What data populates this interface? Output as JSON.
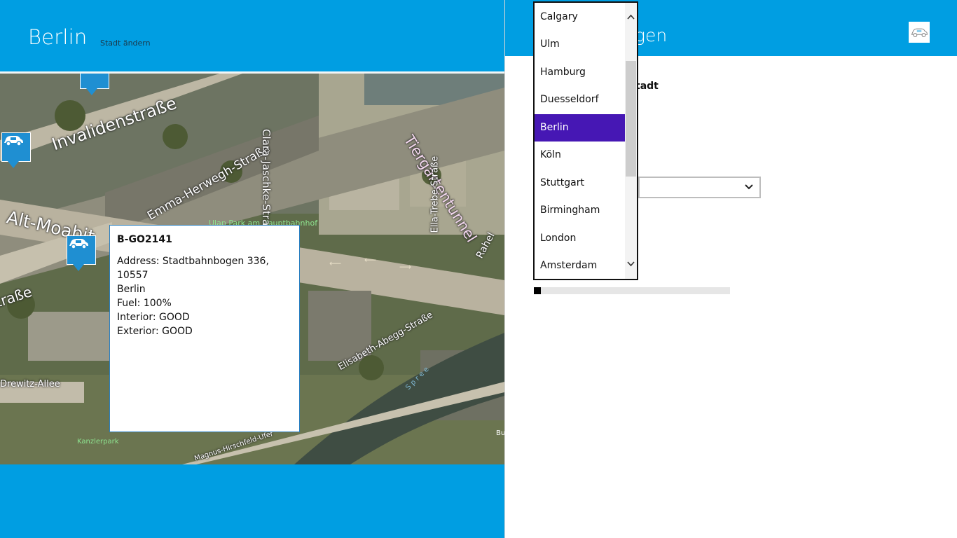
{
  "app": {
    "title": "Berlin",
    "change_city_label": "Stadt ändern"
  },
  "map": {
    "labels": {
      "invalidenstrasse": "Invalidenstraße",
      "emma_herwegh": "Emma-Herwegh-Straße",
      "alt_moabit": "Alt-Moabit",
      "strasse_left": "traße",
      "ulap_park": "Ulap Park am Hauptbahnhof",
      "clara_jaschke": "Clara-Jaschke-Straße",
      "tiergartentunnel": "Tiergartentunnel",
      "ella_trebe": "Ella-Trebe-Straße",
      "rahel": "Rahel",
      "elisabeth_abegg": "Elisabeth-Abegg-Straße",
      "drewitz_allee": "Drewitz-Allee",
      "kanzlerpark": "Kanzlerpark",
      "magnus_hirschfeld": "Magnus-Hirschfeld-Ufer",
      "spree": "S p r e e",
      "bu": "Bu"
    }
  },
  "popup": {
    "title": "B-GO2141",
    "lines": [
      "Address: Stadtbahnbogen 336, 10557",
      "Berlin",
      "Fuel: 100%",
      "Interior: GOOD",
      "Exterior: GOOD"
    ]
  },
  "settings": {
    "title_visible": "gen",
    "city_label_visible": "tadt",
    "progress": 0.036
  },
  "dropdown": {
    "selected": "Berlin",
    "items": [
      "Calgary",
      "Ulm",
      "Hamburg",
      "Duesseldorf",
      "Berlin",
      "Köln",
      "Stuttgart",
      "Birmingham",
      "London",
      "Amsterdam"
    ]
  },
  "colors": {
    "accent": "#009ee2",
    "selected_item": "#4617b4",
    "pin": "#1f8fd2"
  },
  "icons": {
    "car": "car-icon",
    "chevron_down": "chevron-down-icon",
    "scroll_up": "chevron-up-icon",
    "scroll_down": "chevron-down-icon"
  }
}
